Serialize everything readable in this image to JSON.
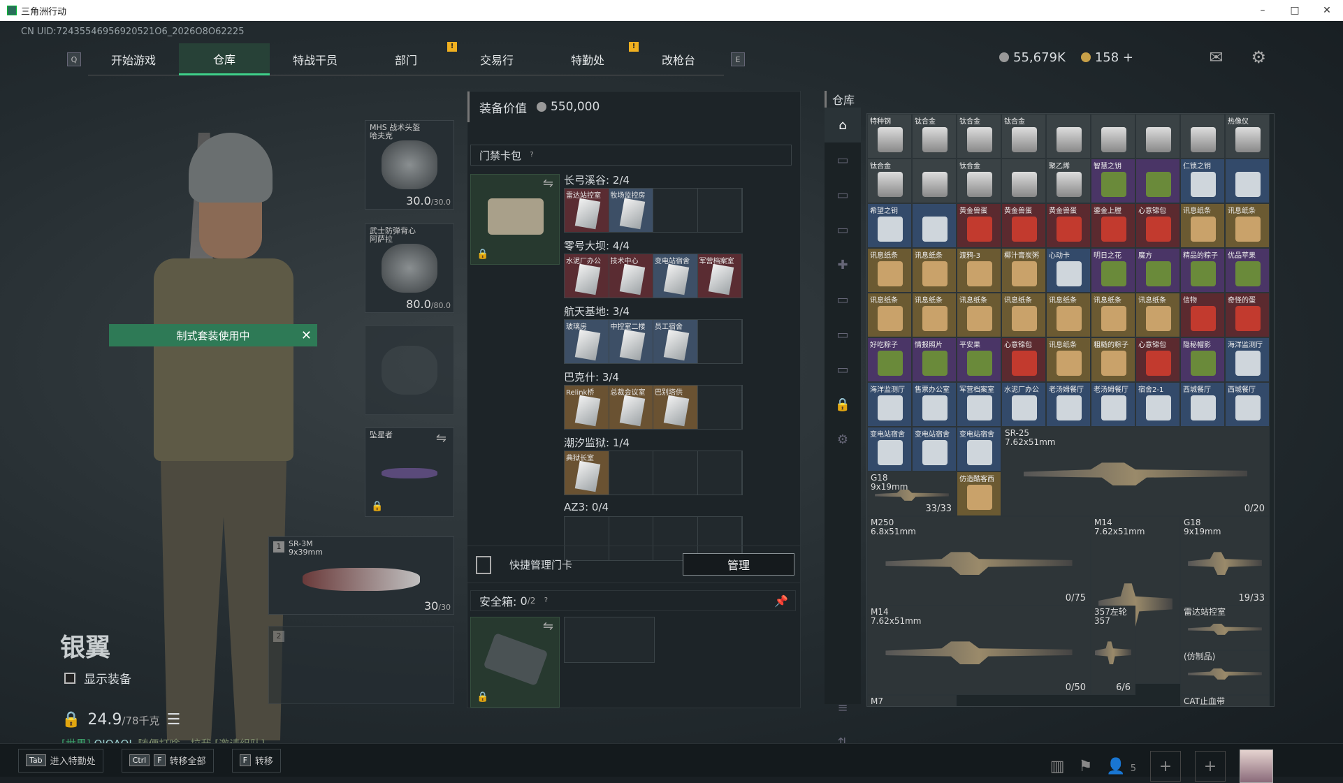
{
  "window": {
    "title": "三角洲行动",
    "min": "–",
    "max": "□",
    "close": "✕"
  },
  "uid": "CN UID:72435546956920521O6_2026O8O62225",
  "nav": {
    "left_key": "Q",
    "right_key": "E",
    "tabs": [
      "开始游戏",
      "仓库",
      "特战干员",
      "部门",
      "交易行",
      "特勤处",
      "改枪台"
    ],
    "active": 1,
    "alert_mark": "!"
  },
  "currency": {
    "silver": "55,679K",
    "gold": "158",
    "add": "+"
  },
  "character": {
    "kit_banner": "制式套装使用中",
    "rank": "银翼",
    "show_equip": "显示装备",
    "weight": "24.9",
    "weight_max": "/78千克",
    "chat_channel": "[世界]",
    "chat_user": "QIQAQL",
    "chat_msg": "随便打啥，拉我",
    "chat_invite": "[邀请组队]"
  },
  "gear": {
    "helmet": {
      "label": "MHS 战术头盔\n哈夫克",
      "value": "30.0",
      "max": "/30.0"
    },
    "armor": {
      "label": "武士防弹背心\n阿萨拉",
      "value": "80.0",
      "max": "/80.0"
    },
    "melee": {
      "label": "坠星者"
    },
    "primary": {
      "slot": "1",
      "name": "SR-3M",
      "caliber": "9x39mm",
      "ammo": "30",
      "max": "/30"
    },
    "secondary": {
      "slot": "2"
    }
  },
  "middle": {
    "title": "装备价值",
    "value": "550,000",
    "pack_title": "门禁卡包",
    "qmark": "?",
    "regions": [
      {
        "name": "长弓溪谷: 2/4",
        "cards": [
          {
            "n": "雷达站控室",
            "c": "red"
          },
          {
            "n": "牧场监控房",
            "c": "blue"
          },
          {
            "n": ""
          },
          {
            "n": ""
          }
        ]
      },
      {
        "name": "零号大坝: 4/4",
        "cards": [
          {
            "n": "水泥厂办公",
            "c": "red"
          },
          {
            "n": "技术中心",
            "c": "red"
          },
          {
            "n": "变电站宿舍",
            "c": "blue"
          },
          {
            "n": "军营档案室",
            "c": "red"
          }
        ]
      },
      {
        "name": "航天基地: 3/4",
        "cards": [
          {
            "n": "玻璃房",
            "c": "blue"
          },
          {
            "n": "中控室二楼",
            "c": "blue"
          },
          {
            "n": "员工宿舍",
            "c": "blue"
          },
          {
            "n": ""
          }
        ]
      },
      {
        "name": "巴克什: 3/4",
        "cards": [
          {
            "n": "Relink桥",
            "c": "gold"
          },
          {
            "n": "总裁会议室",
            "c": "gold"
          },
          {
            "n": "巴别塔供",
            "c": "gold"
          },
          {
            "n": ""
          }
        ]
      },
      {
        "name": "潮汐监狱: 1/4",
        "cards": [
          {
            "n": "典狱长室",
            "c": "gold"
          },
          {
            "n": ""
          },
          {
            "n": ""
          },
          {
            "n": ""
          }
        ]
      },
      {
        "name": "AZ3: 0/4",
        "cards": [
          {
            "n": ""
          },
          {
            "n": ""
          },
          {
            "n": ""
          },
          {
            "n": ""
          }
        ]
      }
    ],
    "quick": "快捷管理门卡",
    "manage": "管理",
    "safe_label": "安全箱:",
    "safe_count": "0",
    "safe_max": "/2"
  },
  "warehouse": {
    "title": "仓库",
    "rows": [
      [
        {
          "n": "特种钢",
          "c": "grey"
        },
        {
          "n": "钛合金",
          "c": "grey"
        },
        {
          "n": "钛合金",
          "c": "grey"
        },
        {
          "n": "钛合金",
          "c": "grey"
        },
        {
          "n": "",
          "c": "grey"
        },
        {
          "n": "",
          "c": "grey"
        },
        {
          "n": "",
          "c": "grey"
        },
        {
          "n": "",
          "c": "grey"
        },
        {
          "n": "热像仪",
          "c": "grey"
        }
      ],
      [
        {
          "n": "钛合金",
          "c": "grey"
        },
        {
          "n": "",
          "c": "grey"
        },
        {
          "n": "钛合金",
          "c": "grey"
        },
        {
          "n": "",
          "c": "grey"
        },
        {
          "n": "聚乙烯",
          "c": "grey"
        },
        {
          "n": "智慧之钥",
          "c": "purple"
        },
        {
          "n": "",
          "c": "purple"
        },
        {
          "n": "仁锁之钥",
          "c": "blue"
        },
        {
          "n": "",
          "c": "blue"
        }
      ],
      [
        {
          "n": "希望之钥",
          "c": "blue"
        },
        {
          "n": "",
          "c": "blue"
        },
        {
          "n": "黄金兽蛋",
          "c": "red"
        },
        {
          "n": "黄金兽蛋",
          "c": "red"
        },
        {
          "n": "黄金兽蛋",
          "c": "red"
        },
        {
          "n": "鎏金上膛",
          "c": "red"
        },
        {
          "n": "心意锦包",
          "c": "red"
        },
        {
          "n": "讯息纸条",
          "c": "gold"
        },
        {
          "n": "讯息纸条",
          "c": "gold"
        }
      ],
      [
        {
          "n": "讯息纸条",
          "c": "gold"
        },
        {
          "n": "讯息纸条",
          "c": "gold"
        },
        {
          "n": "渡鸦-3",
          "c": "gold"
        },
        {
          "n": "椰汁膏炭粥",
          "c": "gold"
        },
        {
          "n": "心动卡",
          "c": "blue"
        },
        {
          "n": "明日之花",
          "c": "purple"
        },
        {
          "n": "魔方",
          "c": "purple"
        },
        {
          "n": "精品的粽子",
          "c": "purple"
        },
        {
          "n": "优品苹果",
          "c": "purple"
        }
      ],
      [
        {
          "n": "讯息纸条",
          "c": "gold"
        },
        {
          "n": "讯息纸条",
          "c": "gold"
        },
        {
          "n": "讯息纸条",
          "c": "gold"
        },
        {
          "n": "讯息纸条",
          "c": "gold"
        },
        {
          "n": "讯息纸条",
          "c": "gold"
        },
        {
          "n": "讯息纸条",
          "c": "gold"
        },
        {
          "n": "讯息纸条",
          "c": "gold"
        },
        {
          "n": "信物",
          "c": "red"
        },
        {
          "n": "奇怪的蛋",
          "c": "red"
        }
      ],
      [
        {
          "n": "好吃粽子",
          "c": "purple"
        },
        {
          "n": "情报照片",
          "c": "purple"
        },
        {
          "n": "平安果",
          "c": "purple"
        },
        {
          "n": "心意锦包",
          "c": "red"
        },
        {
          "n": "讯息纸条",
          "c": "gold"
        },
        {
          "n": "粗糙的粽子",
          "c": "gold"
        },
        {
          "n": "心意锦包",
          "c": "red"
        },
        {
          "n": "隐秘帽影",
          "c": "purple"
        },
        {
          "n": "海洋监测厅",
          "c": "blue"
        }
      ],
      [
        {
          "n": "海洋监测厅",
          "c": "blue"
        },
        {
          "n": "售票办公室",
          "c": "blue"
        },
        {
          "n": "军营档案室",
          "c": "blue"
        },
        {
          "n": "水泥厂办公",
          "c": "blue"
        },
        {
          "n": "老汤姆餐厅",
          "c": "blue"
        },
        {
          "n": "老汤姆餐厅",
          "c": "blue"
        },
        {
          "n": "宿舍2-1",
          "c": "blue"
        },
        {
          "n": "西城餐厅",
          "c": "blue"
        },
        {
          "n": "西城餐厅",
          "c": "blue"
        }
      ],
      [
        {
          "n": "变电站宿舍",
          "c": "blue"
        },
        {
          "n": "变电站宿舍",
          "c": "blue"
        },
        {
          "n": "变电站宿舍",
          "c": "blue"
        }
      ],
      [
        {
          "n": "",
          "c": "grey"
        },
        {
          "n": "",
          "c": "grey"
        },
        {
          "n": "仿造酷客西",
          "c": "gold"
        }
      ]
    ],
    "big": [
      {
        "n": "SR-25\n7.62x51mm",
        "cnt": "0/20"
      },
      {
        "n": "G18\n9x19mm",
        "cnt": "33/33"
      },
      {
        "n": "M250\n6.8x51mm",
        "cnt": "0/75"
      },
      {
        "n": "M14\n7.62x51mm",
        "cnt": ""
      },
      {
        "n": "G18\n9x19mm",
        "cnt": "19/33"
      },
      {
        "n": "M14\n7.62x51mm",
        "cnt": "0/50"
      },
      {
        "n": "357左轮\n357",
        "cnt": "6/6"
      },
      {
        "n": "雷达站控室",
        "cnt": ""
      },
      {
        "n": "(仿制品)",
        "cnt": ""
      },
      {
        "n": "M7",
        "cnt": ""
      },
      {
        "n": "CAT止血带",
        "cnt": ""
      }
    ]
  },
  "bottom": {
    "hints": [
      {
        "k1": "Tab",
        "k2": "",
        "label": "进入特勤处"
      },
      {
        "k1": "Ctrl",
        "k2": "F",
        "label": "转移全部"
      },
      {
        "k1": "F",
        "k2": "",
        "label": "转移"
      }
    ],
    "friends": "5"
  }
}
